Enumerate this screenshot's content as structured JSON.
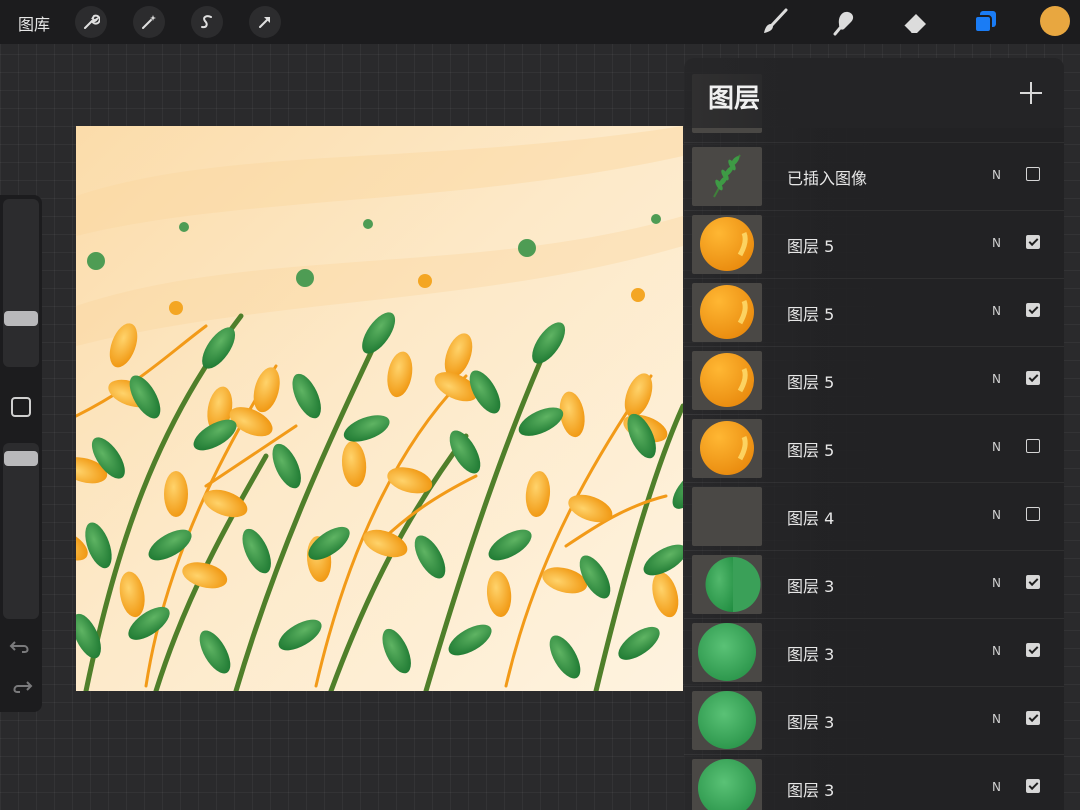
{
  "topbar": {
    "gallery_label": "图库",
    "left_tools": [
      "wrench-icon",
      "magic-wand-icon",
      "selection-s-icon",
      "transform-arrow-icon"
    ],
    "right_tools": [
      "brush-icon",
      "smudge-icon",
      "eraser-icon",
      "layers-icon"
    ],
    "current_color": "#e8a740"
  },
  "layers_panel": {
    "title": "图层",
    "layers": [
      {
        "name": "已插入图像",
        "blend": "N",
        "visible": false,
        "thumb": "sprig"
      },
      {
        "name": "图层 5",
        "blend": "N",
        "visible": true,
        "thumb": "orange"
      },
      {
        "name": "图层 5",
        "blend": "N",
        "visible": true,
        "thumb": "orange"
      },
      {
        "name": "图层 5",
        "blend": "N",
        "visible": true,
        "thumb": "orange"
      },
      {
        "name": "图层 5",
        "blend": "N",
        "visible": false,
        "thumb": "orange"
      },
      {
        "name": "图层 4",
        "blend": "N",
        "visible": false,
        "thumb": "empty"
      },
      {
        "name": "图层 3",
        "blend": "N",
        "visible": true,
        "thumb": "green-half"
      },
      {
        "name": "图层 3",
        "blend": "N",
        "visible": true,
        "thumb": "green"
      },
      {
        "name": "图层 3",
        "blend": "N",
        "visible": true,
        "thumb": "green"
      },
      {
        "name": "图层 3",
        "blend": "N",
        "visible": true,
        "thumb": "green"
      }
    ]
  },
  "colors": {
    "accent_blue": "#1a7cf5",
    "canvas_bg": "#fce8c4",
    "leaf_green": "#2f8a3a",
    "leaf_orange": "#f4a623"
  }
}
